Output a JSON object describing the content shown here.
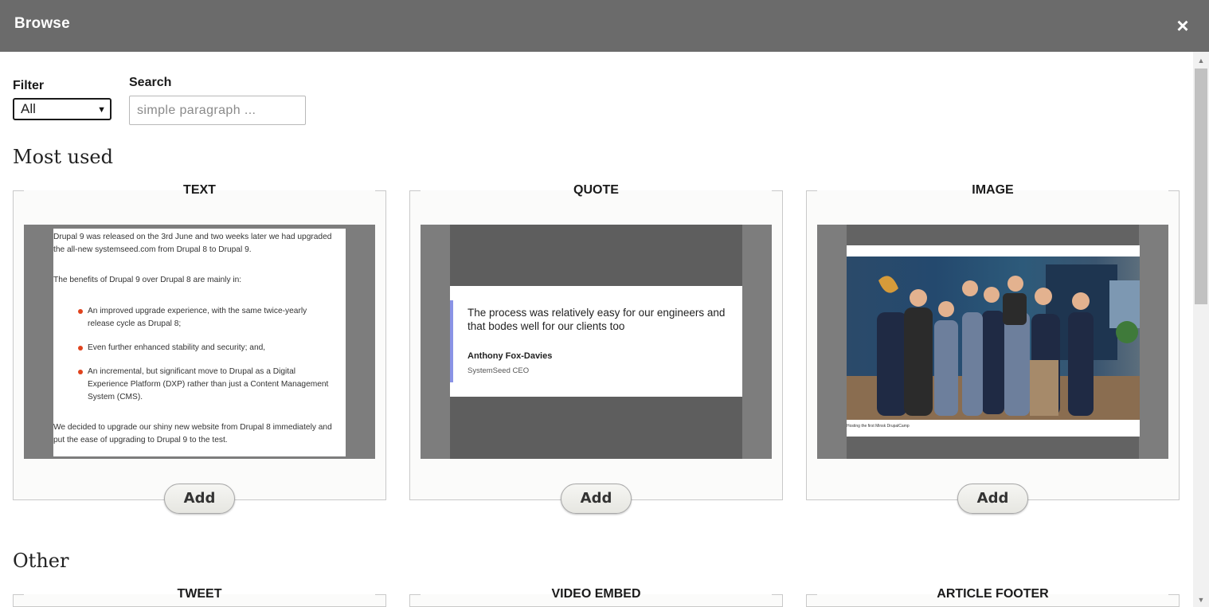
{
  "dialog": {
    "title": "Browse",
    "close_icon": "×"
  },
  "filters": {
    "filter_label": "Filter",
    "filter_value": "All",
    "search_label": "Search",
    "search_placeholder": "simple paragraph ..."
  },
  "sections": {
    "most_used": "Most used",
    "other": "Other"
  },
  "cards": [
    {
      "title": "TEXT",
      "add_label": "Add"
    },
    {
      "title": "QUOTE",
      "add_label": "Add"
    },
    {
      "title": "IMAGE",
      "add_label": "Add"
    }
  ],
  "other_cards": [
    {
      "title": "TWEET"
    },
    {
      "title": "VIDEO EMBED"
    },
    {
      "title": "ARTICLE FOOTER"
    }
  ],
  "text_preview": {
    "para1": "Drupal 9 was released on the 3rd June and two weeks later we had upgraded the all-new systemseed.com from Drupal 8 to Drupal 9.",
    "para2": "The benefits of Drupal 9 over Drupal 8 are mainly in:",
    "bullets": [
      "An improved upgrade experience, with the same twice-yearly release cycle as Drupal 8;",
      "Even further enhanced stability and security; and,",
      "An incremental, but significant move to Drupal as a Digital Experience Platform (DXP) rather than just a Content Management System (CMS)."
    ],
    "para3": "We decided to upgrade our shiny new website from Drupal 8 immediately and put the ease of upgrading to Drupal 9 to the test."
  },
  "quote_preview": {
    "quote": "The process was relatively easy for our engineers and that bodes well for our clients too",
    "author": "Anthony Fox-Davies",
    "role": "SystemSeed CEO"
  },
  "image_preview": {
    "caption": "Hosting the first Minsk DrupalCamp"
  }
}
